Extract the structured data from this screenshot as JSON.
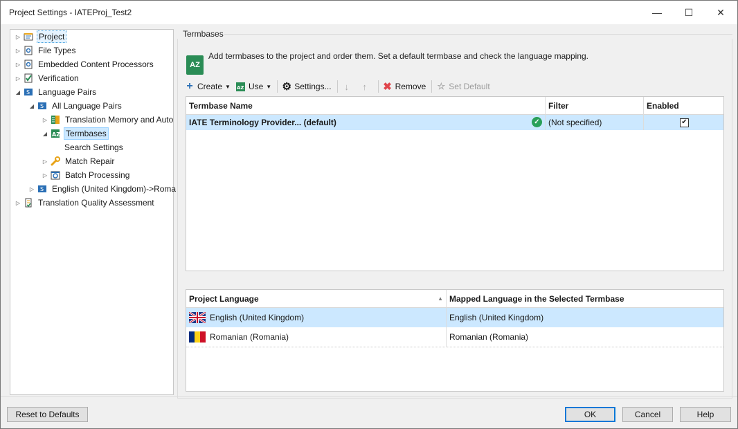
{
  "window": {
    "title": "Project Settings - IATEProj_Test2",
    "minimize_glyph": "—",
    "maximize_glyph": "☐",
    "close_glyph": "✕"
  },
  "tree": {
    "items": [
      {
        "label": "Project",
        "icon": "project-icon"
      },
      {
        "label": "File Types",
        "icon": "file-types-icon"
      },
      {
        "label": "Embedded Content Processors",
        "icon": "embedded-content-icon"
      },
      {
        "label": "Verification",
        "icon": "verification-icon"
      },
      {
        "label": "Language Pairs",
        "icon": "language-pairs-icon"
      },
      {
        "label": "All Language Pairs",
        "icon": "language-pairs-icon"
      },
      {
        "label": "Translation Memory and Auto",
        "icon": "translation-memory-icon"
      },
      {
        "label": "Termbases",
        "icon": "termbases-icon"
      },
      {
        "label": "Search Settings",
        "icon": ""
      },
      {
        "label": "Match Repair",
        "icon": "wrench-icon"
      },
      {
        "label": "Batch Processing",
        "icon": "batch-processing-icon"
      },
      {
        "label": "English (United Kingdom)->Roma",
        "icon": "language-pairs-icon"
      },
      {
        "label": "Translation Quality Assessment",
        "icon": "quality-assessment-icon"
      }
    ]
  },
  "section": {
    "title": "Termbases",
    "description": "Add termbases to the project and order them. Set a default termbase and check the language mapping."
  },
  "toolbar": {
    "create": "Create",
    "use": "Use",
    "settings": "Settings...",
    "remove": "Remove",
    "set_default": "Set Default"
  },
  "termbase_table": {
    "headers": {
      "name": "Termbase Name",
      "filter": "Filter",
      "enabled": "Enabled"
    },
    "rows": [
      {
        "name": "IATE Terminology Provider... (default)",
        "filter": "(Not specified)",
        "enabled": true
      }
    ]
  },
  "language_table": {
    "headers": {
      "project_language": "Project Language",
      "mapped_language": "Mapped Language in the Selected Termbase"
    },
    "rows": [
      {
        "project_language": "English (United Kingdom)",
        "mapped_language": "English (United Kingdom)",
        "flag": "uk-flag-icon"
      },
      {
        "project_language": "Romanian (Romania)",
        "mapped_language": "Romanian (Romania)",
        "flag": "romania-flag-icon"
      }
    ]
  },
  "footer": {
    "reset": "Reset to Defaults",
    "ok": "OK",
    "cancel": "Cancel",
    "help": "Help"
  },
  "colors": {
    "selection": "#cce8ff",
    "accent": "#0078d7",
    "termbase_green": "#2a8c55"
  }
}
